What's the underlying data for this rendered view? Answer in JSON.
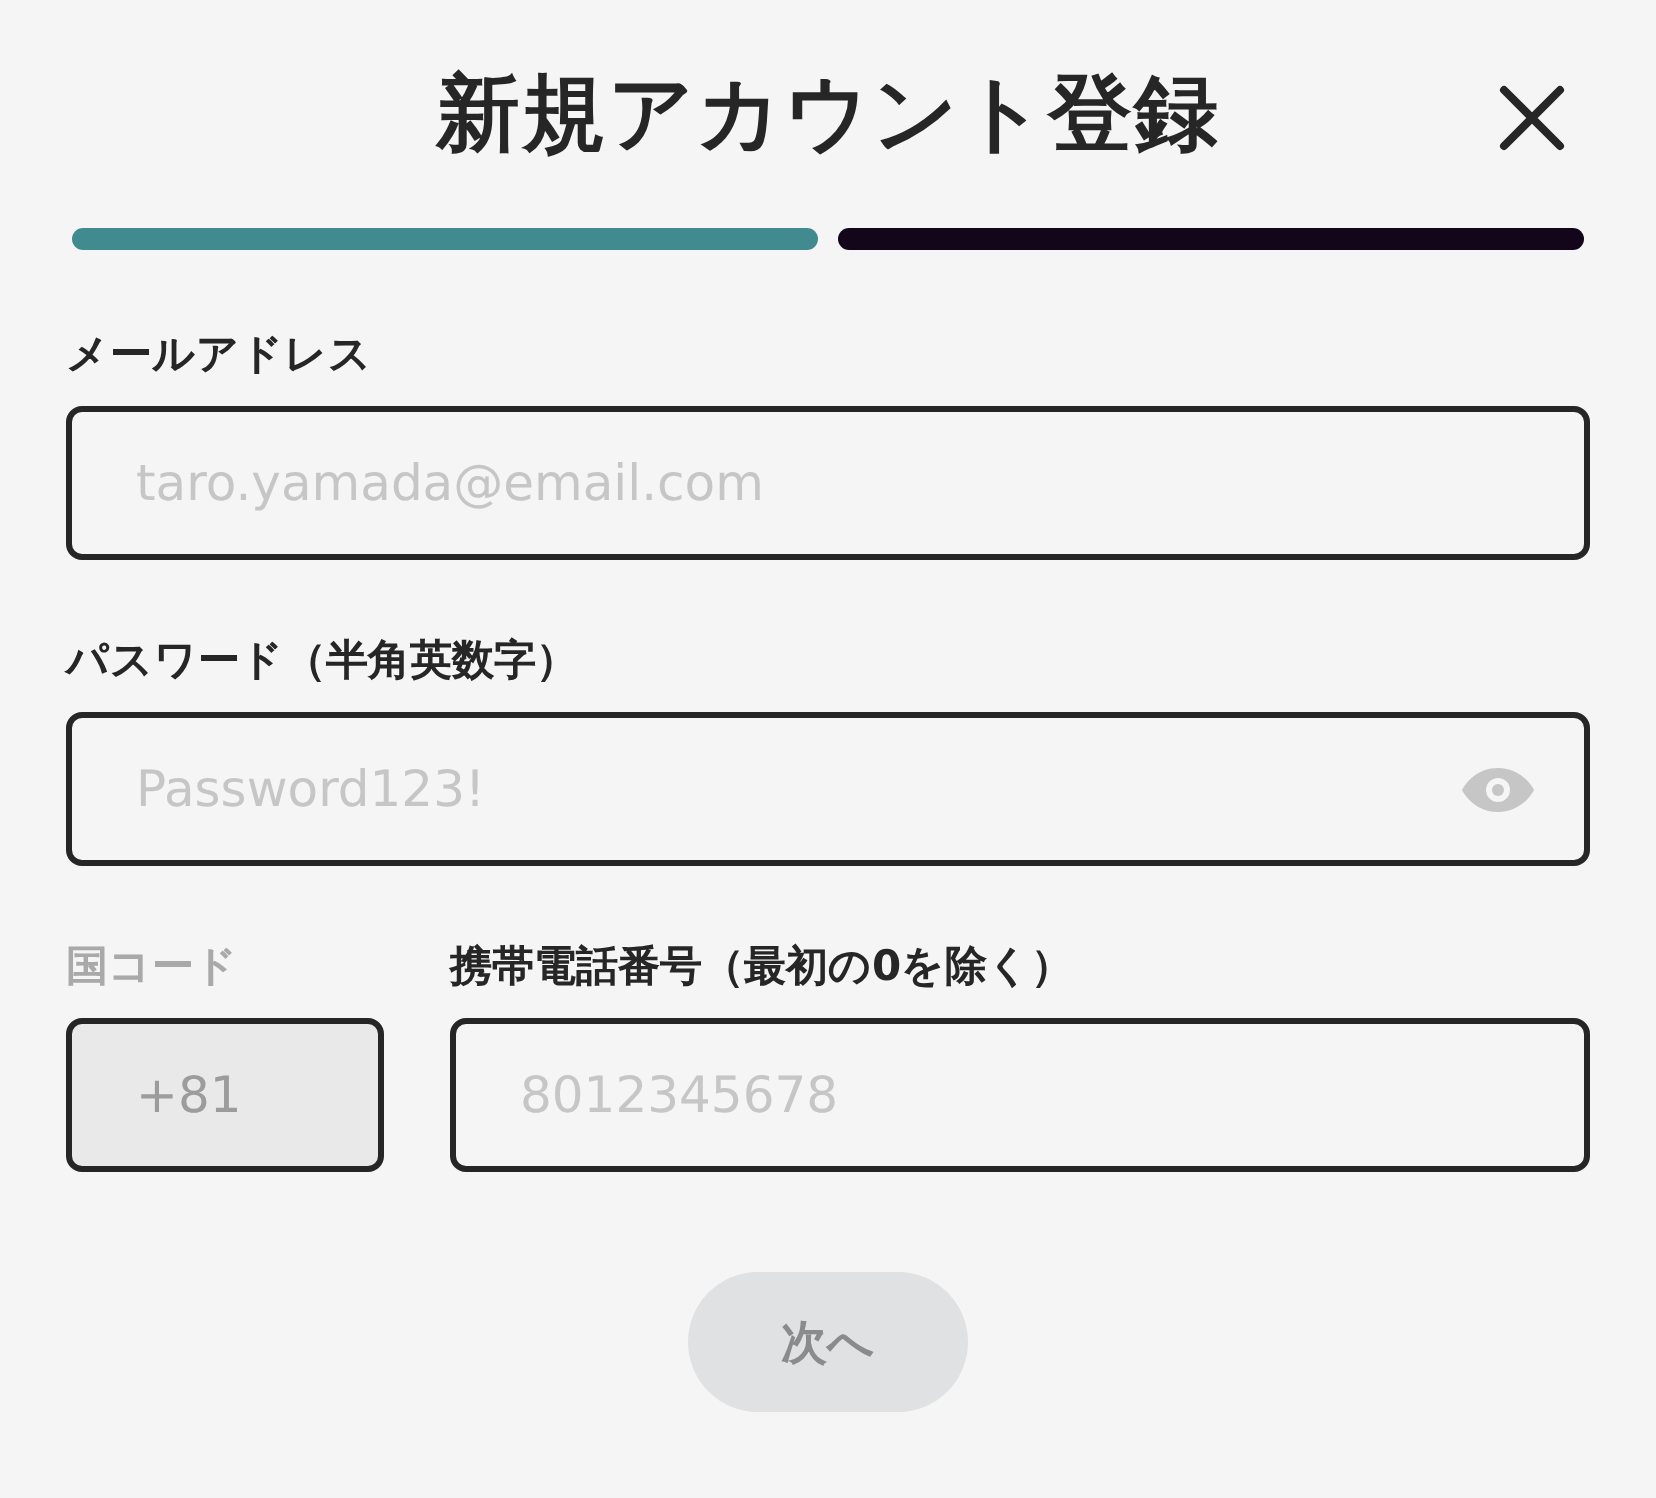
{
  "title": "新規アカウント登録",
  "progress": [
    {
      "color": "#418a90"
    },
    {
      "color": "#14061a"
    }
  ],
  "email": {
    "label": "メールアドレス",
    "placeholder": "taro.yamada@email.com"
  },
  "password": {
    "label": "パスワード（半角英数字）",
    "placeholder": "Password123!"
  },
  "country_code": {
    "label": "国コード",
    "value": "+81",
    "disabled": true
  },
  "phone": {
    "label": "携帯電話番号（最初の0を除く）",
    "placeholder": "8012345678"
  },
  "next_button": {
    "label": "次へ",
    "disabled": true
  }
}
